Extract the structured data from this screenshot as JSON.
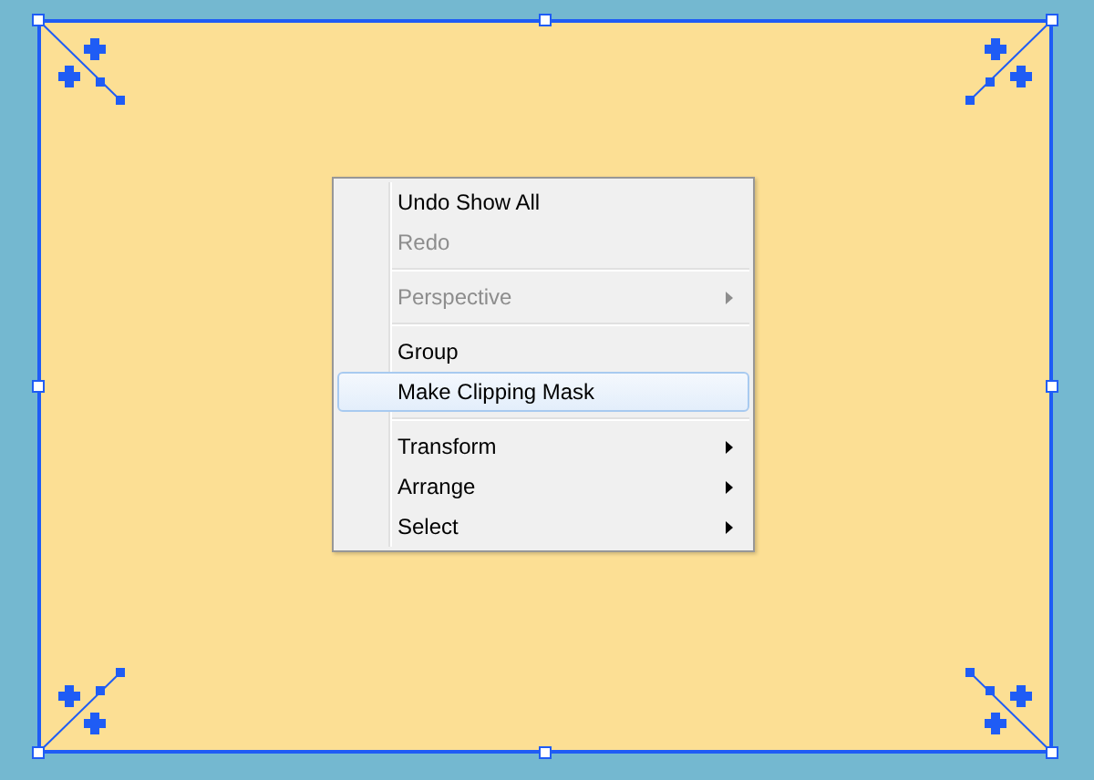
{
  "context_menu": {
    "items": [
      {
        "kind": "item",
        "label": "Undo Show All",
        "disabled": false,
        "selected": false,
        "submenu": false
      },
      {
        "kind": "item",
        "label": "Redo",
        "disabled": true,
        "selected": false,
        "submenu": false
      },
      {
        "kind": "separator"
      },
      {
        "kind": "item",
        "label": "Perspective",
        "disabled": true,
        "selected": false,
        "submenu": true
      },
      {
        "kind": "separator"
      },
      {
        "kind": "item",
        "label": "Group",
        "disabled": false,
        "selected": false,
        "submenu": false
      },
      {
        "kind": "item",
        "label": "Make Clipping Mask",
        "disabled": false,
        "selected": true,
        "submenu": false
      },
      {
        "kind": "separator"
      },
      {
        "kind": "item",
        "label": "Transform",
        "disabled": false,
        "selected": false,
        "submenu": true
      },
      {
        "kind": "item",
        "label": "Arrange",
        "disabled": false,
        "selected": false,
        "submenu": true
      },
      {
        "kind": "item",
        "label": "Select",
        "disabled": false,
        "selected": false,
        "submenu": true
      }
    ]
  }
}
